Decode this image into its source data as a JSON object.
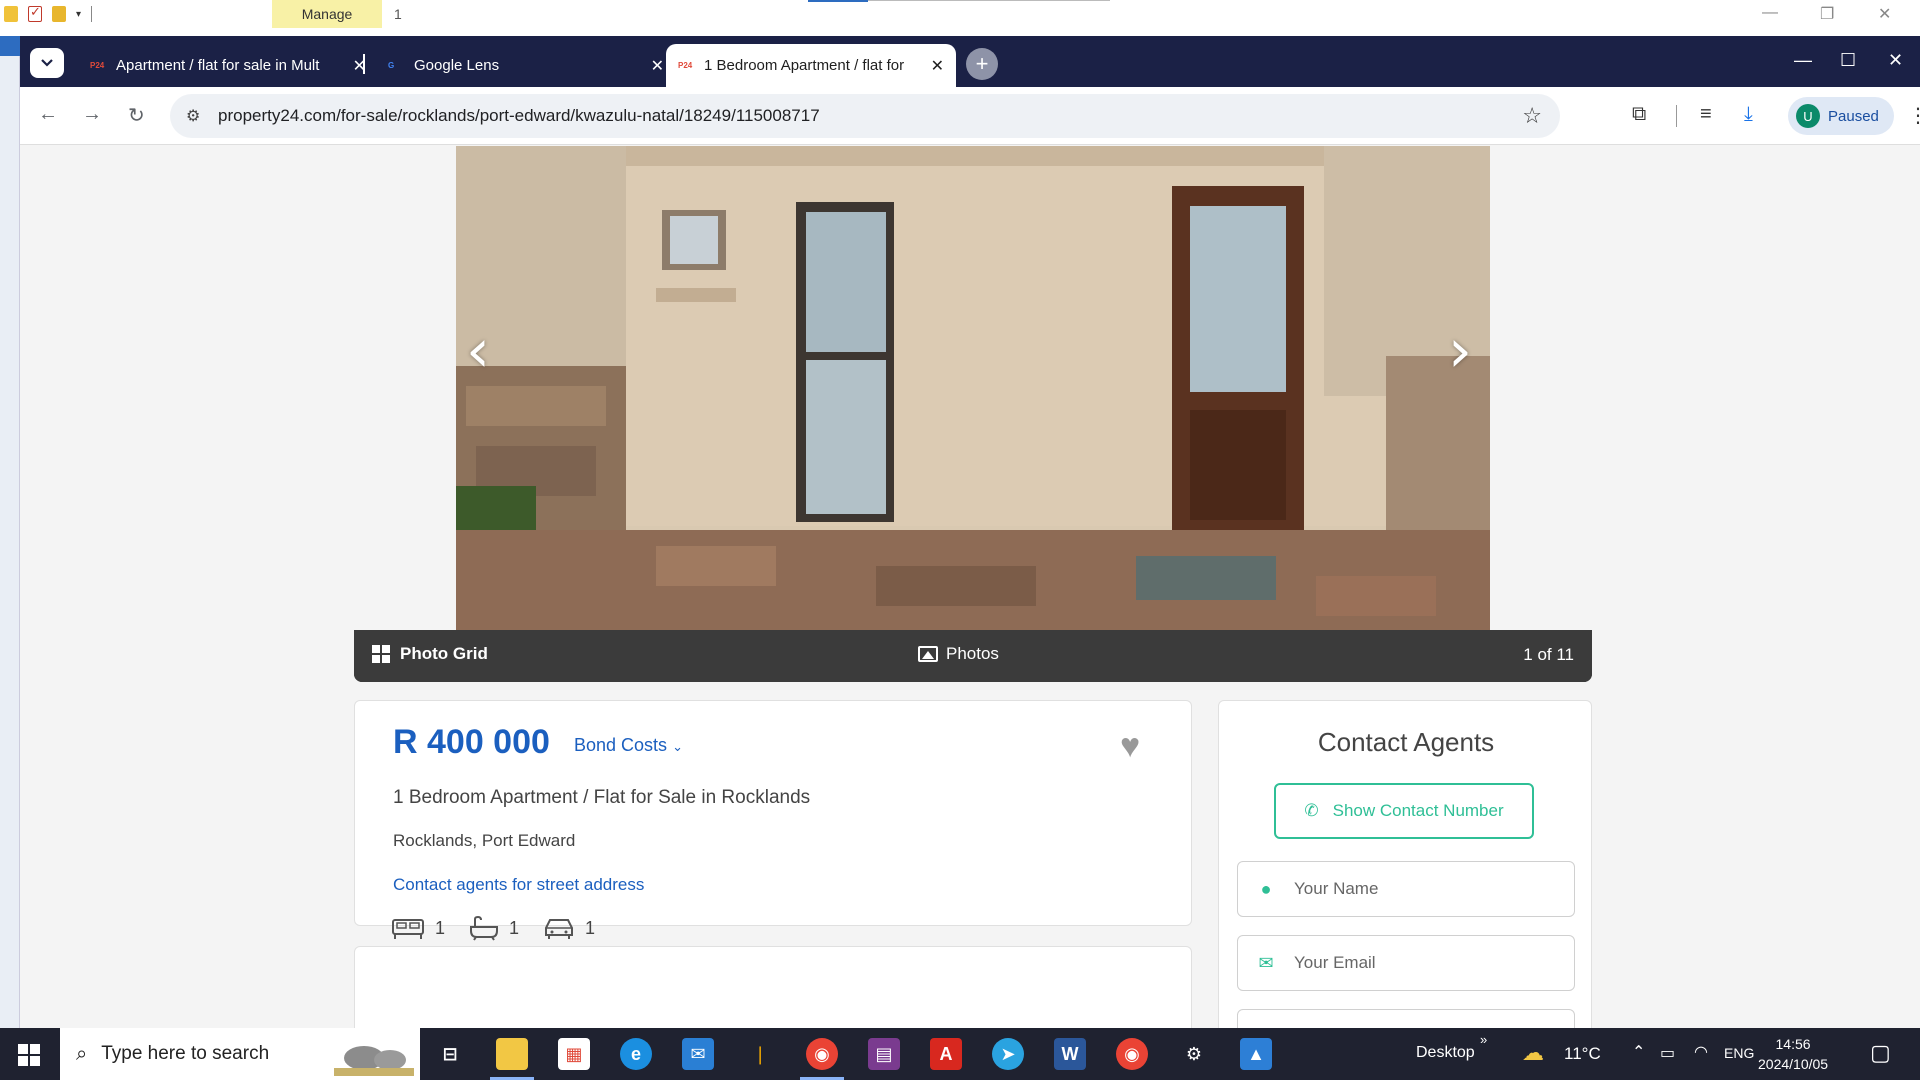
{
  "explorer": {
    "manage_label": "Manage",
    "number": "1"
  },
  "browser": {
    "tabs": [
      {
        "favicon": "P24",
        "title": "Apartment / flat for sale in Mult"
      },
      {
        "favicon": "G",
        "title": "Google Lens"
      },
      {
        "favicon": "P24",
        "title": "1 Bedroom Apartment / flat for"
      }
    ],
    "url": "property24.com/for-sale/rocklands/port-edward/kwazulu-natal/18249/115008717",
    "profile": {
      "initial": "U",
      "status": "Paused"
    }
  },
  "gallery": {
    "photo_grid_label": "Photo Grid",
    "photos_label": "Photos",
    "counter": "1 of 11"
  },
  "listing": {
    "price": "R 400 000",
    "bond_costs_label": "Bond Costs",
    "title": "1 Bedroom Apartment / Flat for Sale in Rocklands",
    "location": "Rocklands, Port Edward",
    "contact_link": "Contact agents for street address",
    "features": {
      "bedrooms": "1",
      "bathrooms": "1",
      "parking": "1"
    }
  },
  "contact": {
    "heading": "Contact Agents",
    "show_number_label": "Show Contact Number",
    "name_placeholder": "Your Name",
    "email_placeholder": "Your Email"
  },
  "taskbar": {
    "search_placeholder": "Type here to search",
    "desktop_label": "Desktop",
    "temperature": "11°C",
    "language": "ENG",
    "time": "14:56",
    "date": "2024/10/05"
  },
  "colors": {
    "brand_blue": "#1b5fbf",
    "accent_green": "#2fbf96",
    "tabbar": "#1b2146"
  }
}
